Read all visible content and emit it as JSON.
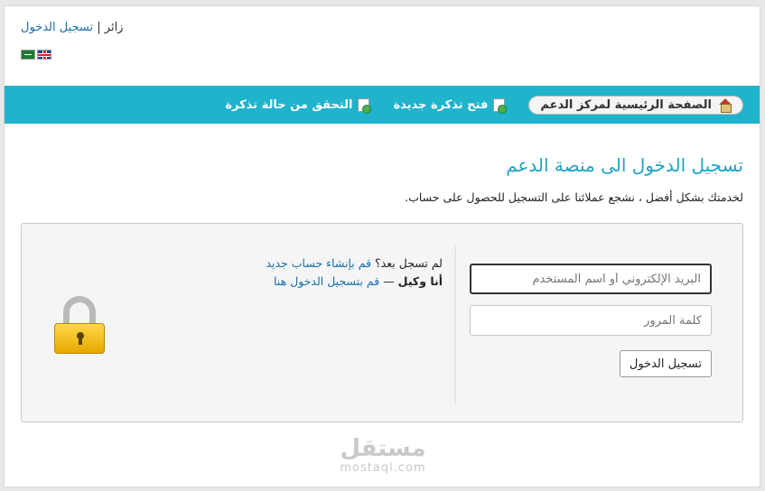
{
  "header": {
    "visitor_label": "زائر",
    "separator": "|",
    "login_link": "تسجيل الدخول",
    "flags": [
      "saudi-flag-icon",
      "uk-flag-icon"
    ]
  },
  "nav": {
    "items": [
      {
        "label": "الصفحة الرئيسية لمركز الدعم",
        "icon": "home-icon"
      },
      {
        "label": "فتح تذكرة جديدة",
        "icon": "new-ticket-icon"
      },
      {
        "label": "التحقق من حالة تذكرة",
        "icon": "ticket-status-icon"
      }
    ],
    "bar_color": "#1fb3cc"
  },
  "main": {
    "title": "تسجيل الدخول الى منصة الدعم",
    "subtitle": "لخدمتك بشكل أفضل ، نشجع عملائنا على التسجيل للحصول على حساب."
  },
  "form": {
    "username_placeholder": "البريد الإلكتروني أو اسم المستخدم",
    "password_placeholder": "كلمة المرور",
    "submit_label": "تسجيل الدخول"
  },
  "links": {
    "not_registered": "لم تسجل بعد؟",
    "create_account": "قم بإنشاء حساب جديد",
    "agent_label": "أنا وكيل",
    "dash": "—",
    "agent_login": "قم بتسجيل الدخول هنا"
  },
  "watermark": {
    "arabic": "مستقل",
    "latin": "mostaql.com"
  },
  "colors": {
    "accent": "#1fa3c4",
    "link": "#1a6fa8"
  }
}
